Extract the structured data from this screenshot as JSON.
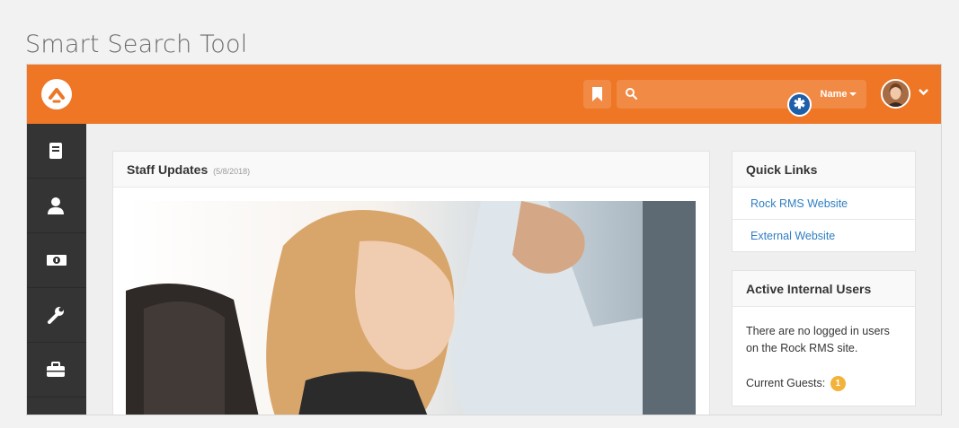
{
  "page": {
    "heading": "Smart Search Tool"
  },
  "topbar": {
    "search": {
      "value": "",
      "placeholder": "",
      "type_label": "Name"
    },
    "marker_symbol": "✱",
    "colors": {
      "bar": "#ee7625",
      "marker": "#1f5ea8",
      "link": "#2f7ec3",
      "badge": "#f3b23a"
    }
  },
  "sidenav": {
    "items": [
      {
        "icon": "book-icon"
      },
      {
        "icon": "user-icon"
      },
      {
        "icon": "money-icon"
      },
      {
        "icon": "wrench-icon"
      },
      {
        "icon": "briefcase-icon"
      }
    ]
  },
  "staff_updates": {
    "title": "Staff Updates",
    "date": "(5/8/2018)"
  },
  "quick_links": {
    "title": "Quick Links",
    "links": [
      "Rock RMS Website",
      "External Website"
    ]
  },
  "active_users": {
    "title": "Active Internal Users",
    "message": "There are no logged in users on the Rock RMS site.",
    "guests_label": "Current Guests:",
    "guests_count": "1"
  }
}
